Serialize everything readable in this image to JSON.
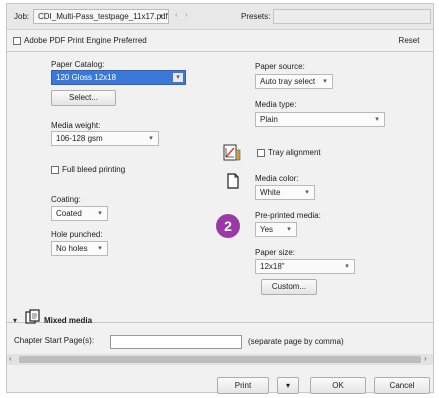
{
  "toolbar": {
    "job_label": "Job:",
    "job_value": "CDI_Multi-Pass_testpage_11x17.pdf",
    "presets_label": "Presets:",
    "presets_value": ""
  },
  "adobe_pdf_engine_label": "Adobe PDF Print Engine Preferred",
  "reset_label": "Reset",
  "left": {
    "paper_catalog_label": "Paper Catalog:",
    "paper_catalog_value": "120 Gloss 12x18",
    "select_button": "Select...",
    "media_weight_label": "Media weight:",
    "media_weight_value": "106-128 gsm",
    "full_bleed_label": "Full bleed printing",
    "coating_label": "Coating:",
    "coating_value": "Coated",
    "hole_punched_label": "Hole punched:",
    "hole_punched_value": "No holes"
  },
  "right": {
    "paper_source_label": "Paper source:",
    "paper_source_value": "Auto tray select",
    "media_type_label": "Media type:",
    "media_type_value": "Plain",
    "tray_alignment_label": "Tray alignment",
    "media_color_label": "Media color:",
    "media_color_value": "White",
    "preprinted_label": "Pre-printed media:",
    "preprinted_value": "Yes",
    "paper_size_label": "Paper size:",
    "paper_size_value": "12x18\"",
    "custom_button": "Custom..."
  },
  "badge": {
    "number": "2",
    "color": "#9b3aa6"
  },
  "mixed_media": {
    "title": "Mixed media",
    "chapter_label": "Chapter Start Page(s):",
    "chapter_value": "",
    "hint": "(separate page by comma)"
  },
  "footer": {
    "print_label": "Print",
    "print_menu_glyph": "▾",
    "ok_label": "OK",
    "cancel_label": "Cancel"
  }
}
